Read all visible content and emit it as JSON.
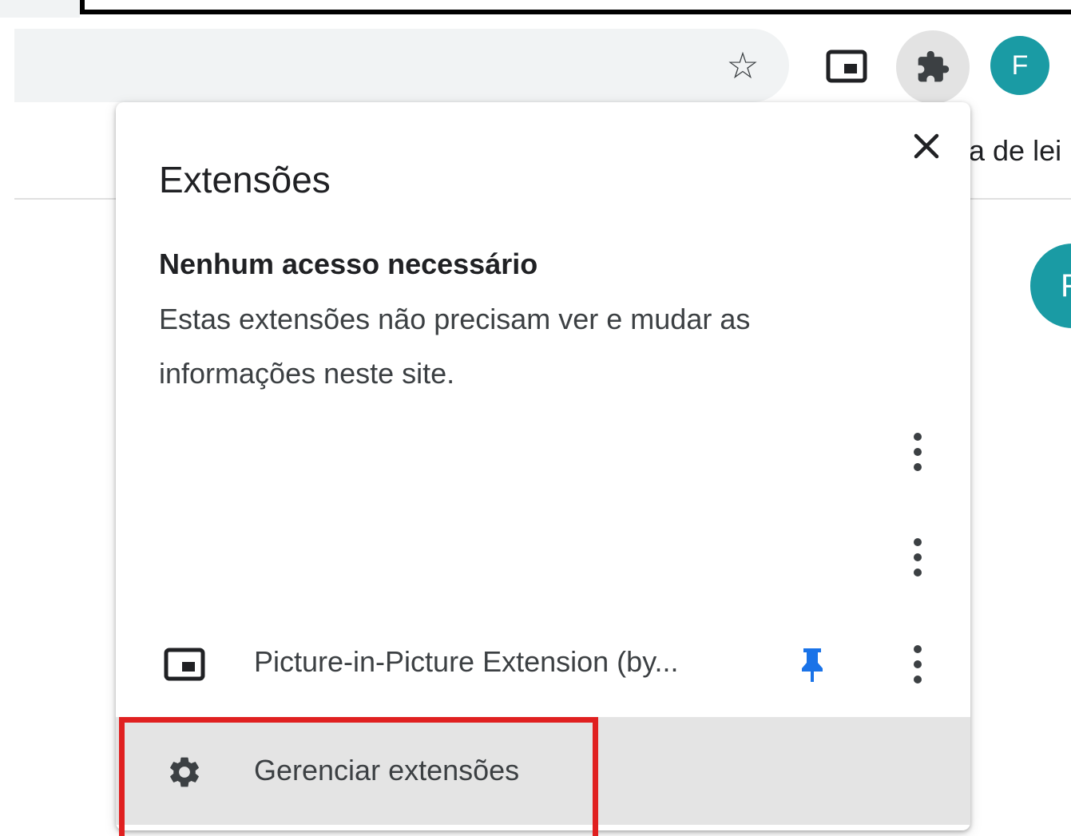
{
  "toolbar": {
    "bookmark_icon": "star-outline-icon",
    "pip_icon": "picture-in-picture-icon",
    "extensions_icon": "puzzle-piece-icon",
    "profile_initial": "F",
    "profile_color": "#1a9ba4"
  },
  "page": {
    "bookmark_bar_text": "a de lei",
    "profile_initial": "F"
  },
  "popup": {
    "title": "Extensões",
    "close_icon": "close-icon",
    "section_heading": "Nenhum acesso necessário",
    "section_description": "Estas extensões não precisam ver e mudar as informações neste site.",
    "extensions": [
      {
        "name": "Picture-in-Picture Extension (by...",
        "icon": "picture-in-picture-icon",
        "pinned": true,
        "pin_color": "#1a73e8"
      }
    ],
    "manage_label": "Gerenciar extensões",
    "manage_icon": "gear-icon"
  },
  "annotation": {
    "highlight_color": "#e02020"
  }
}
